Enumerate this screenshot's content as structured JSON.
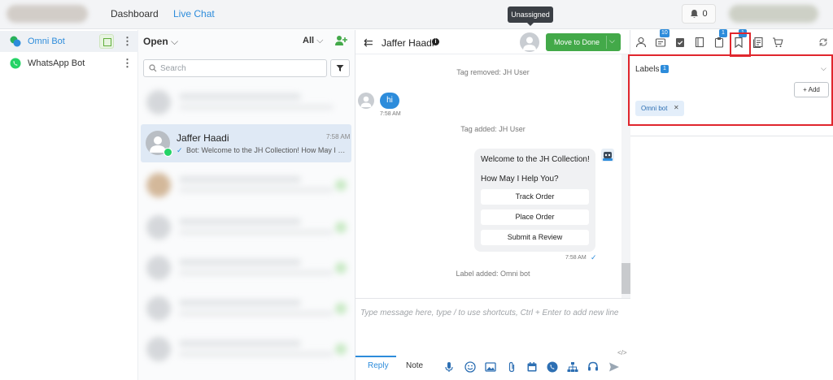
{
  "topbar": {
    "nav": {
      "dashboard": "Dashboard",
      "live_chat": "Live Chat"
    },
    "notifications_count": "0"
  },
  "sidebar": {
    "items": [
      {
        "label": "Omni Bot",
        "active": true
      },
      {
        "label": "WhatsApp Bot",
        "active": false
      }
    ]
  },
  "conv_list": {
    "status_filter": "Open",
    "assignee_filter": "All",
    "search_placeholder": "Search",
    "selected": {
      "name": "Jaffer Haadi",
      "time": "7:58 AM",
      "tick": "✓",
      "preview": "Bot: Welcome to the JH Collection! How May I Help You?"
    }
  },
  "chat": {
    "contact_name": "Jaffer Haadi",
    "assignee_tooltip": "Unassigned",
    "move_to_done": "Move to Done",
    "messages": {
      "tag_removed": "Tag removed: JH User",
      "user_text": "hi",
      "user_time": "7:58 AM",
      "tag_added": "Tag added: JH User",
      "bot_line1": "Welcome to the JH Collection!",
      "bot_line2": "How May I Help You?",
      "quick_replies": [
        "Track Order",
        "Place Order",
        "Submit a Review"
      ],
      "bot_time": "7:58 AM",
      "label_added": "Label added: Omni bot"
    },
    "composer": {
      "placeholder": "Type message here, type / to use shortcuts, Ctrl + Enter to add new line",
      "tab_reply": "Reply",
      "tab_note": "Note"
    }
  },
  "right_panel": {
    "badges": {
      "notes": "10",
      "tasks": "1",
      "labels": "1"
    },
    "labels": {
      "title": "Labels",
      "count": "1",
      "add_button": "+ Add",
      "chips": [
        "Omni bot"
      ]
    }
  },
  "colors": {
    "accent_blue": "#2d8cdb",
    "done_green": "#43a949",
    "highlight_red": "#e0262d",
    "whatsapp_green": "#25d366"
  }
}
